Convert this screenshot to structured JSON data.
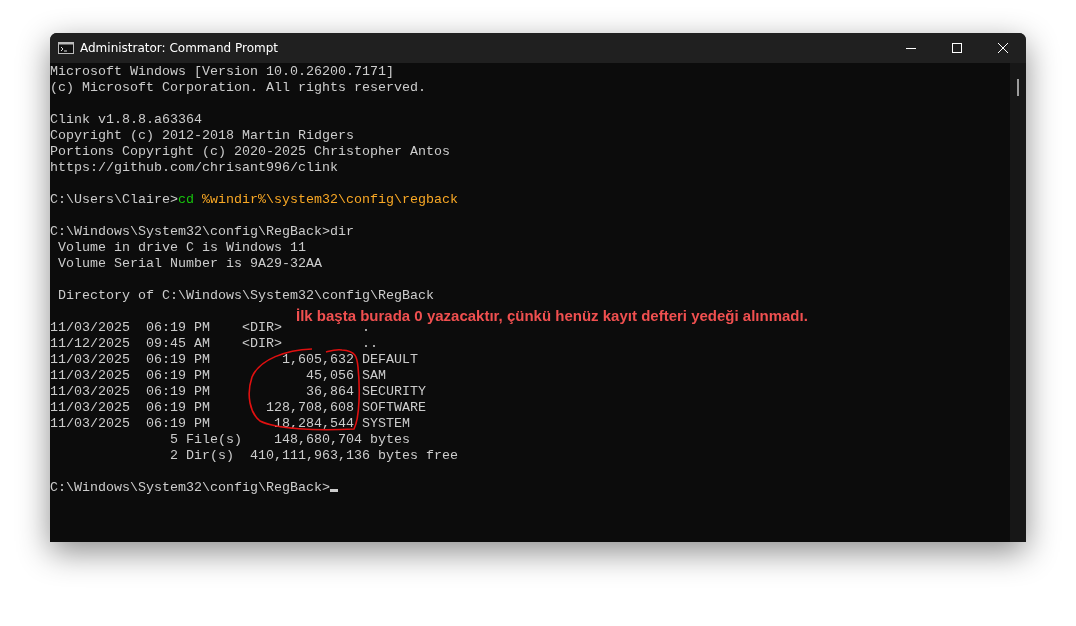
{
  "window": {
    "title": "Administrator: Command Prompt"
  },
  "console": {
    "lines": [
      {
        "kind": "text",
        "text": "Microsoft Windows [Version 10.0.26200.7171]"
      },
      {
        "kind": "text",
        "text": "(c) Microsoft Corporation. All rights reserved."
      },
      {
        "kind": "blank"
      },
      {
        "kind": "text",
        "text": "Clink v1.8.8.a63364"
      },
      {
        "kind": "text",
        "text": "Copyright (c) 2012-2018 Martin Ridgers"
      },
      {
        "kind": "text",
        "text": "Portions Copyright (c) 2020-2025 Christopher Antos"
      },
      {
        "kind": "text",
        "text": "https://github.com/chrisant996/clink"
      },
      {
        "kind": "blank"
      },
      {
        "kind": "input",
        "prompt": "C:\\Users\\Claire>",
        "command": "cd",
        "argument": " %windir%\\system32\\config\\regback"
      },
      {
        "kind": "blank"
      },
      {
        "kind": "text",
        "text": "C:\\Windows\\System32\\config\\RegBack>dir"
      },
      {
        "kind": "text",
        "text": " Volume in drive C is Windows 11"
      },
      {
        "kind": "text",
        "text": " Volume Serial Number is 9A29-32AA"
      },
      {
        "kind": "blank"
      },
      {
        "kind": "text",
        "text": " Directory of C:\\Windows\\System32\\config\\RegBack"
      },
      {
        "kind": "blank"
      },
      {
        "kind": "text",
        "text": "11/03/2025  06:19 PM    <DIR>          ."
      },
      {
        "kind": "text",
        "text": "11/12/2025  09:45 AM    <DIR>          .."
      },
      {
        "kind": "text",
        "text": "11/03/2025  06:19 PM         1,605,632 DEFAULT"
      },
      {
        "kind": "text",
        "text": "11/03/2025  06:19 PM            45,056 SAM"
      },
      {
        "kind": "text",
        "text": "11/03/2025  06:19 PM            36,864 SECURITY"
      },
      {
        "kind": "text",
        "text": "11/03/2025  06:19 PM       128,708,608 SOFTWARE"
      },
      {
        "kind": "text",
        "text": "11/03/2025  06:19 PM        18,284,544 SYSTEM"
      },
      {
        "kind": "text",
        "text": "               5 File(s)    148,680,704 bytes"
      },
      {
        "kind": "text",
        "text": "               2 Dir(s)  410,111,963,136 bytes free"
      },
      {
        "kind": "blank"
      },
      {
        "kind": "prompt",
        "prompt": "C:\\Windows\\System32\\config\\RegBack>"
      }
    ]
  },
  "annotation": {
    "text": "İlk başta burada 0 yazacaktır, çünkü henüz kayıt defteri yedeği alınmadı."
  }
}
